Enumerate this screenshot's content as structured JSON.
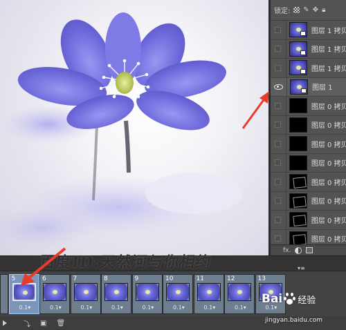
{
  "layers_panel": {
    "lock_label": "锁定:",
    "lock_icons": [
      "checker-lock-icon",
      "brush-lock-icon",
      "move-lock-icon",
      "padlock-icon"
    ],
    "layers": [
      {
        "name": "图层 1 拷贝",
        "visible": false,
        "thumb": "flower"
      },
      {
        "name": "图层 1 拷贝",
        "visible": false,
        "thumb": "flower"
      },
      {
        "name": "图层 1 拷贝",
        "visible": false,
        "thumb": "flower"
      },
      {
        "name": "图层 1",
        "visible": true,
        "thumb": "flower"
      },
      {
        "name": "图层 0 拷贝",
        "visible": false,
        "thumb": "black"
      },
      {
        "name": "图层 0 拷贝",
        "visible": false,
        "thumb": "black"
      },
      {
        "name": "图层 0 拷贝",
        "visible": false,
        "thumb": "black"
      },
      {
        "name": "图层 0 拷贝",
        "visible": false,
        "thumb": "black"
      },
      {
        "name": "图层 0 拷贝",
        "visible": false,
        "thumb": "black-frame"
      },
      {
        "name": "图层 0 拷贝",
        "visible": false,
        "thumb": "black-frame"
      },
      {
        "name": "图层 0 拷贝",
        "visible": false,
        "thumb": "black-frame"
      },
      {
        "name": "图层 0 拷贝",
        "visible": false,
        "thumb": "black-frame"
      }
    ],
    "footer": {
      "fx_label": "fx."
    }
  },
  "timeline": {
    "menu_glyph": "▾≡",
    "frames": [
      {
        "number": "",
        "delay": "",
        "selected": false
      },
      {
        "number": "5",
        "delay": "0.1▾",
        "selected": true
      },
      {
        "number": "6",
        "delay": "0.1▾",
        "selected": false
      },
      {
        "number": "7",
        "delay": "0.1▾",
        "selected": false
      },
      {
        "number": "8",
        "delay": "0.1▾",
        "selected": false
      },
      {
        "number": "9",
        "delay": "0.1▾",
        "selected": false
      },
      {
        "number": "10",
        "delay": "0.1▾",
        "selected": false
      },
      {
        "number": "11",
        "delay": "0.1▾",
        "selected": false
      },
      {
        "number": "12",
        "delay": "0.1▾",
        "selected": false
      },
      {
        "number": "13",
        "delay": "0.1▾",
        "selected": false
      }
    ]
  },
  "watermark": {
    "text": "百度ID:天然河与你相约"
  },
  "baidu": {
    "bai": "Bai",
    "jingyan": "经验",
    "url": "jingyan.baidu.com"
  },
  "colors": {
    "arrow": "#e83b2e",
    "selected_frame": "#7d96b8",
    "flower": "#6e6ad8"
  }
}
